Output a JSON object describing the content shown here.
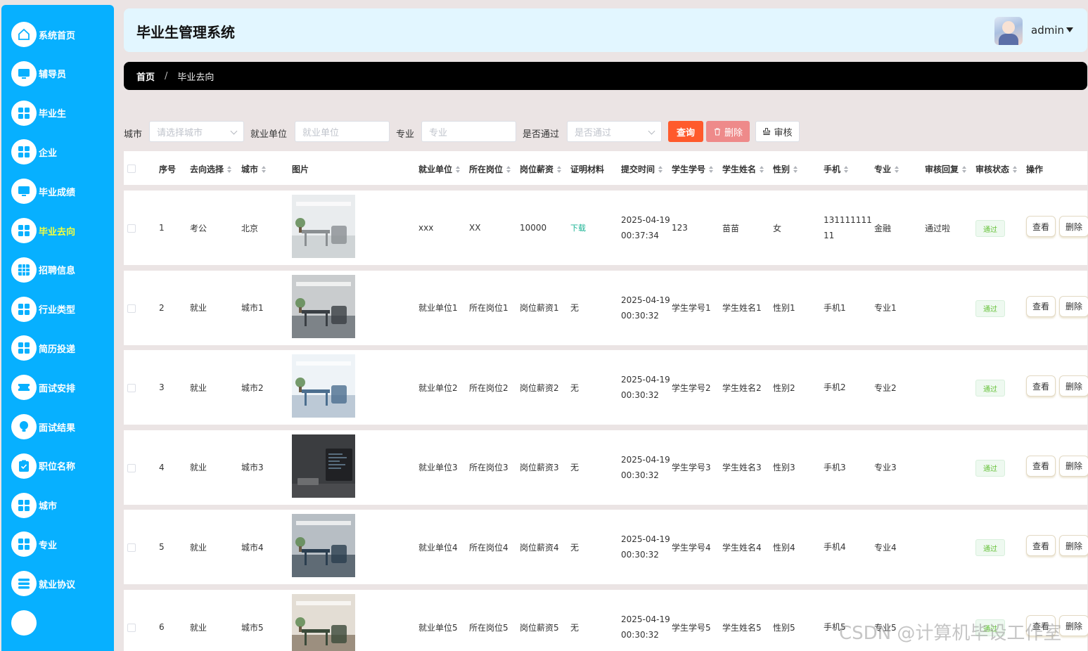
{
  "app": {
    "title": "毕业生管理系统",
    "username": "admin"
  },
  "sidebar": {
    "items": [
      {
        "label": "系统首页",
        "icon": "home-icon",
        "active": false
      },
      {
        "label": "辅导员",
        "icon": "monitor-icon",
        "active": false
      },
      {
        "label": "毕业生",
        "icon": "grid-icon",
        "active": false
      },
      {
        "label": "企业",
        "icon": "grid-icon",
        "active": false
      },
      {
        "label": "毕业成绩",
        "icon": "monitor-icon",
        "active": false
      },
      {
        "label": "毕业去向",
        "icon": "grid-icon",
        "active": true
      },
      {
        "label": "招聘信息",
        "icon": "table-icon",
        "active": false
      },
      {
        "label": "行业类型",
        "icon": "grid-icon",
        "active": false
      },
      {
        "label": "简历投递",
        "icon": "grid-icon",
        "active": false
      },
      {
        "label": "面试安排",
        "icon": "ticket-icon",
        "active": false
      },
      {
        "label": "面试结果",
        "icon": "bulb-icon",
        "active": false
      },
      {
        "label": "职位名称",
        "icon": "clipboard-icon",
        "active": false
      },
      {
        "label": "城市",
        "icon": "grid-icon",
        "active": false
      },
      {
        "label": "专业",
        "icon": "grid-icon",
        "active": false
      },
      {
        "label": "就业协议",
        "icon": "list-icon",
        "active": false
      }
    ]
  },
  "breadcrumb": {
    "home": "首页",
    "separator": "/",
    "current": "毕业去向"
  },
  "filters": {
    "city": {
      "label": "城市",
      "placeholder": "请选择城市"
    },
    "company": {
      "label": "就业单位",
      "placeholder": "就业单位"
    },
    "major": {
      "label": "专业",
      "placeholder": "专业"
    },
    "passed": {
      "label": "是否通过",
      "placeholder": "是否通过"
    },
    "buttons": {
      "query": "查询",
      "delete": "删除",
      "audit": "审核"
    }
  },
  "table": {
    "columns": {
      "index": "序号",
      "choice": "去向选择",
      "city": "城市",
      "image": "图片",
      "company": "就业单位",
      "position": "所在岗位",
      "salary": "岗位薪资",
      "proof": "证明材料",
      "submit_time": "提交时间",
      "student_no": "学生学号",
      "student_name": "学生姓名",
      "gender": "性别",
      "phone": "手机",
      "major": "专业",
      "reply": "审核回复",
      "status": "审核状态",
      "actions": "操作"
    },
    "view_label": "查看",
    "delete_label": "删除",
    "rows": [
      {
        "index": "1",
        "choice": "考公",
        "city": "北京",
        "company": "xxx",
        "position": "XX",
        "salary": "10000",
        "proof": "下载",
        "date": "2025-04-19",
        "time": "00:37:34",
        "student_no": "123",
        "student_name": "苗苗",
        "gender": "女",
        "phone_a": "131111111",
        "phone_b": "11",
        "major": "金融",
        "reply": "通过啦",
        "status": "通过"
      },
      {
        "index": "2",
        "choice": "就业",
        "city": "城市1",
        "company": "就业单位1",
        "position": "所在岗位1",
        "salary": "岗位薪资1",
        "proof": "无",
        "date": "2025-04-19",
        "time": "00:30:32",
        "student_no": "学生学号1",
        "student_name": "学生姓名1",
        "gender": "性别1",
        "phone_a": "手机1",
        "phone_b": "",
        "major": "专业1",
        "reply": "",
        "status": "通过"
      },
      {
        "index": "3",
        "choice": "就业",
        "city": "城市2",
        "company": "就业单位2",
        "position": "所在岗位2",
        "salary": "岗位薪资2",
        "proof": "无",
        "date": "2025-04-19",
        "time": "00:30:32",
        "student_no": "学生学号2",
        "student_name": "学生姓名2",
        "gender": "性别2",
        "phone_a": "手机2",
        "phone_b": "",
        "major": "专业2",
        "reply": "",
        "status": "通过"
      },
      {
        "index": "4",
        "choice": "就业",
        "city": "城市3",
        "company": "就业单位3",
        "position": "所在岗位3",
        "salary": "岗位薪资3",
        "proof": "无",
        "date": "2025-04-19",
        "time": "00:30:32",
        "student_no": "学生学号3",
        "student_name": "学生姓名3",
        "gender": "性别3",
        "phone_a": "手机3",
        "phone_b": "",
        "major": "专业3",
        "reply": "",
        "status": "通过"
      },
      {
        "index": "5",
        "choice": "就业",
        "city": "城市4",
        "company": "就业单位4",
        "position": "所在岗位4",
        "salary": "岗位薪资4",
        "proof": "无",
        "date": "2025-04-19",
        "time": "00:30:32",
        "student_no": "学生学号4",
        "student_name": "学生姓名4",
        "gender": "性别4",
        "phone_a": "手机4",
        "phone_b": "",
        "major": "专业4",
        "reply": "",
        "status": "通过"
      },
      {
        "index": "6",
        "choice": "就业",
        "city": "城市5",
        "company": "就业单位5",
        "position": "所在岗位5",
        "salary": "岗位薪资5",
        "proof": "无",
        "date": "2025-04-19",
        "time": "00:30:32",
        "student_no": "学生学号5",
        "student_name": "学生姓名5",
        "gender": "性别5",
        "phone_a": "手机5",
        "phone_b": "",
        "major": "专业5",
        "reply": "",
        "status": "通过"
      }
    ]
  },
  "watermark": "CSDN @计算机毕设工作室",
  "colors": {
    "sidebar": "#07b0ff",
    "active_label": "#f5ff3c",
    "query_button": "#ff5a2c",
    "delete_button": "#ee8a8a",
    "header_bg": "#e2f6ff",
    "download_link": "#1ab394",
    "status_tag": "#67c23a"
  }
}
